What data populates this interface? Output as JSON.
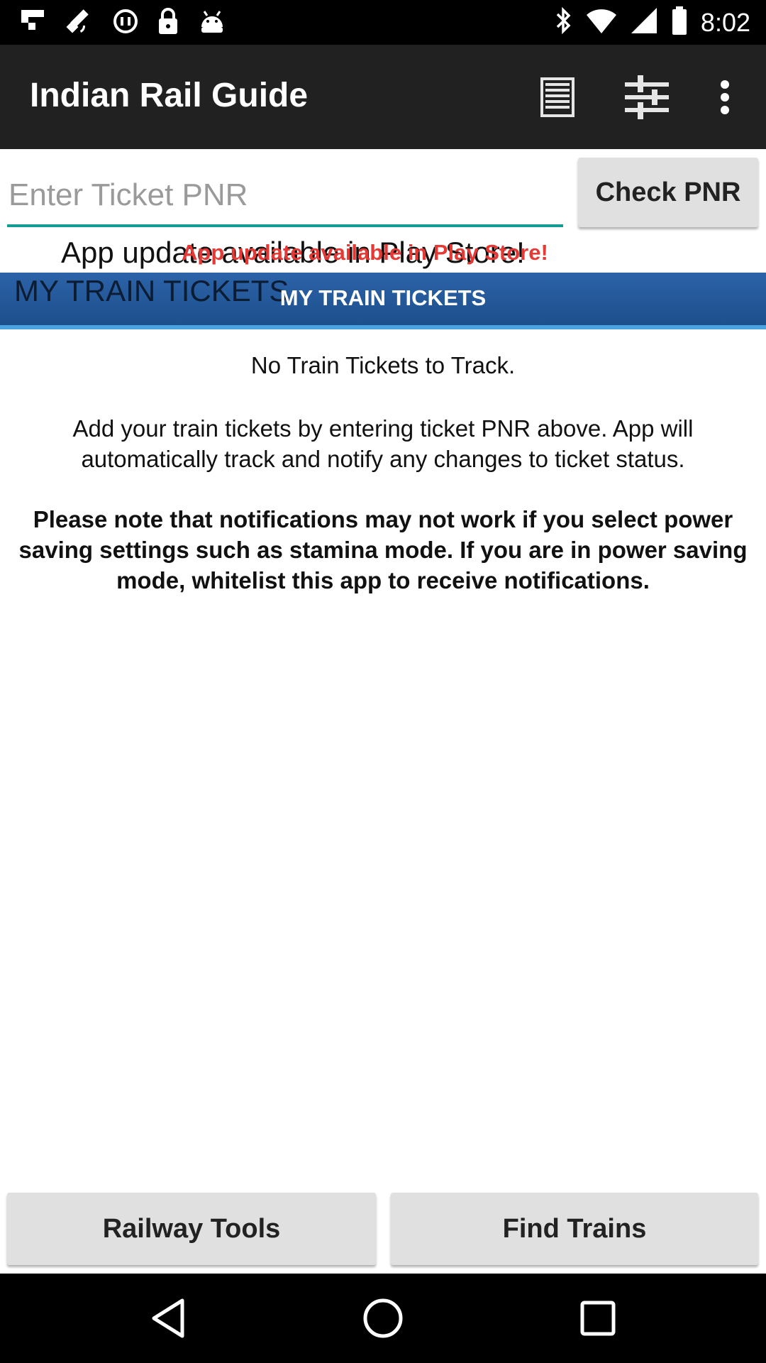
{
  "status_bar": {
    "time": "8:02",
    "left_icons": [
      "flipboard-icon",
      "satellite-icon",
      "sync-icon",
      "lock-icon",
      "android-icon"
    ],
    "right_icons": [
      "bluetooth-icon",
      "wifi-icon",
      "signal-icon",
      "battery-icon"
    ]
  },
  "app_bar": {
    "title": "Indian Rail Guide",
    "actions": [
      "list-icon",
      "sliders-icon",
      "more-vert-icon"
    ]
  },
  "pnr": {
    "placeholder": "Enter Ticket PNR",
    "value": "",
    "button_label": "Check PNR"
  },
  "update_notice": {
    "text_black": "App update available in Play Store!",
    "text_red": "App update available in Play Store!"
  },
  "section": {
    "title_dark": "MY TRAIN TICKETS",
    "title_white": "MY TRAIN TICKETS"
  },
  "content": {
    "empty_title": "No Train Tickets to Track.",
    "add_info": "Add your train tickets by entering ticket PNR above. App will automatically track and notify any changes to ticket status.",
    "note": "Please note that notifications may not work if you select power saving settings such as stamina mode. If you are in power saving mode, whitelist this app to receive notifications."
  },
  "bottom": {
    "left_label": "Railway Tools",
    "right_label": "Find Trains"
  },
  "nav": [
    "back-icon",
    "home-icon",
    "recents-icon"
  ],
  "colors": {
    "app_bar": "#212121",
    "accent_teal": "#139b96",
    "header_blue": "#1c4f8c",
    "header_underline": "#4aa3df",
    "notice_red": "#e53935",
    "button_gray": "#e0e0e0"
  }
}
